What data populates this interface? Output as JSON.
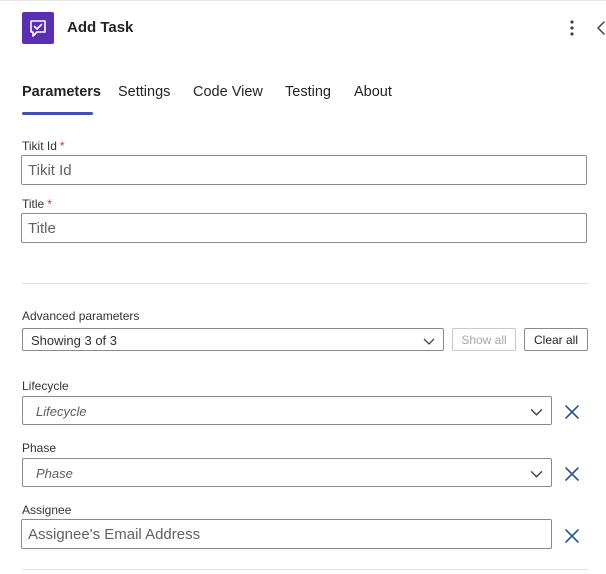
{
  "header": {
    "title": "Add Task",
    "icon": "task-chat-icon",
    "accent": "#5b2fb3"
  },
  "tabs": [
    {
      "label": "Parameters",
      "active": true
    },
    {
      "label": "Settings",
      "active": false
    },
    {
      "label": "Code View",
      "active": false
    },
    {
      "label": "Testing",
      "active": false
    },
    {
      "label": "About",
      "active": false
    }
  ],
  "fields": {
    "tikit_id": {
      "label": "Tikit Id",
      "required_mark": "*",
      "placeholder": "Tikit Id",
      "value": ""
    },
    "title": {
      "label": "Title",
      "required_mark": "*",
      "placeholder": "Title",
      "value": ""
    }
  },
  "advanced": {
    "label": "Advanced parameters",
    "selected": "Showing 3 of 3",
    "show_all": "Show all",
    "clear_all": "Clear all"
  },
  "optional": {
    "lifecycle": {
      "label": "Lifecycle",
      "placeholder": "Lifecycle"
    },
    "phase": {
      "label": "Phase",
      "placeholder": "Phase"
    },
    "assignee": {
      "label": "Assignee",
      "placeholder": "Assignee's Email Address",
      "value": ""
    }
  },
  "colors": {
    "tab_underline": "#3f51b5",
    "remove_icon": "#2b5797",
    "required": "#c4314b"
  }
}
